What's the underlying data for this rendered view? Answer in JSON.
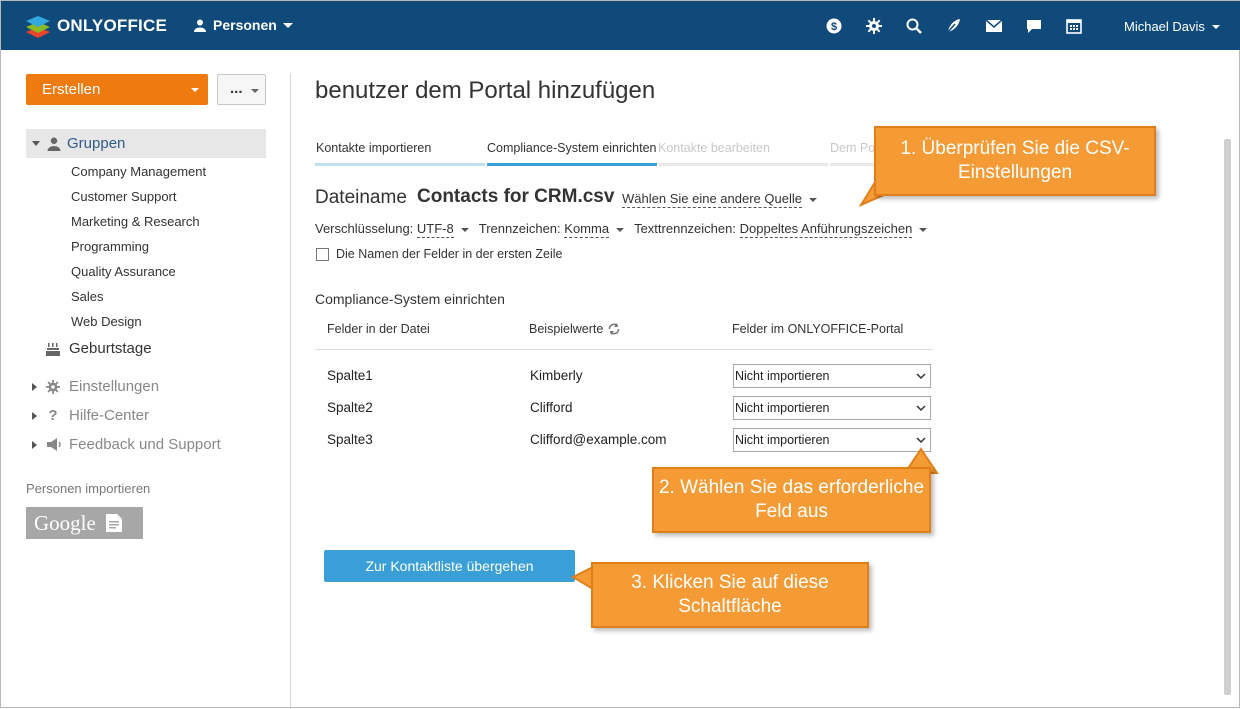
{
  "header": {
    "logo_text": "ONLYOFFICE",
    "module_label": "Personen",
    "icons": [
      "currency-icon",
      "gear-icon",
      "search-icon",
      "feed-icon",
      "mail-icon",
      "chat-icon",
      "calendar-icon"
    ],
    "user_name": "Michael Davis",
    "bg_color": "#0f4a7b"
  },
  "sidebar": {
    "create_label": "Erstellen",
    "more_label": "...",
    "groups_label": "Gruppen",
    "groups": [
      "Company Management",
      "Customer Support",
      "Marketing & Research",
      "Programming",
      "Quality Assurance",
      "Sales",
      "Web Design"
    ],
    "birthdays_label": "Geburtstage",
    "settings_label": "Einstellungen",
    "help_label": "Hilfe-Center",
    "feedback_label": "Feedback und Support",
    "import_label": "Personen importieren",
    "google_label": "Google"
  },
  "main": {
    "title": "benutzer dem Portal hinzufügen",
    "steps": [
      {
        "label": "Kontakte importieren",
        "state": "done"
      },
      {
        "label": "Compliance-System einrichten",
        "state": "active"
      },
      {
        "label": "Kontakte bearbeiten",
        "state": "pending"
      },
      {
        "label": "Dem Po",
        "state": "pending"
      }
    ],
    "filename_label": "Dateiname",
    "filename": "Contacts for CRM.csv",
    "source_link": "Wählen Sie eine andere Quelle",
    "encoding_label": "Verschlüsselung:",
    "encoding_value": "UTF-8",
    "separator_label": "Trennzeichen:",
    "separator_value": "Komma",
    "text_sep_label": "Texttrennzeichen:",
    "text_sep_value": "Doppeltes Anführungszeichen",
    "header_checkbox_label": "Die Namen der Felder in der ersten Zeile",
    "section_title": "Compliance-System einrichten",
    "columns": [
      "Felder in der Datei",
      "Beispielwerte",
      "Felder im ONLYOFFICE-Portal"
    ],
    "rows": [
      {
        "field": "Spalte1",
        "sample": "Kimberly",
        "mapping": "Nicht importieren"
      },
      {
        "field": "Spalte2",
        "sample": "Clifford",
        "mapping": "Nicht importieren"
      },
      {
        "field": "Spalte3",
        "sample": "Clifford@example.com",
        "mapping": "Nicht importieren"
      }
    ],
    "submit_label": "Zur Kontaktliste übergehen"
  },
  "callouts": {
    "c1": "1. Überprüfen Sie die CSV-Einstellungen",
    "c2": "2. Wählen Sie das erforderliche Feld aus",
    "c3": "3. Klicken Sie auf diese Schaltfläche"
  },
  "colors": {
    "accent_orange": "#ee7a10",
    "button_blue": "#3a9fd7",
    "callout": "#f49b36"
  }
}
